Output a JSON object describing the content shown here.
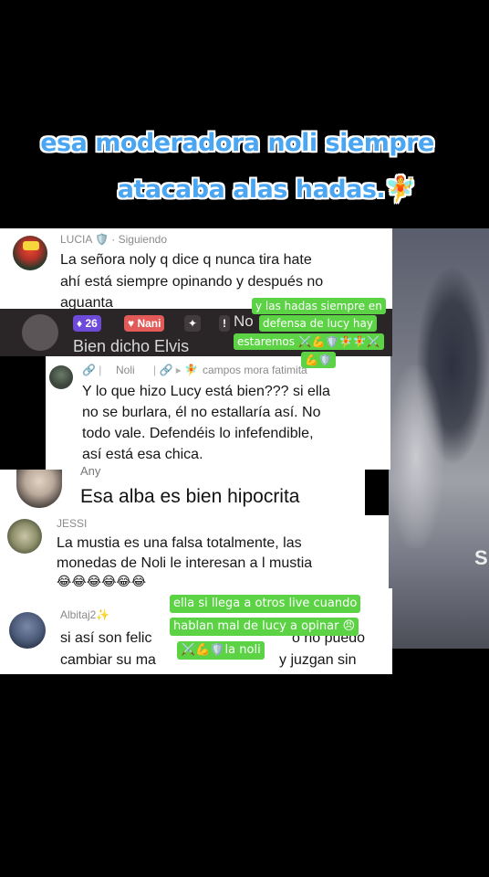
{
  "caption": {
    "line1": "esa moderadora noli siempre",
    "line2": "atacaba alas hadas.🧚"
  },
  "comments": [
    {
      "user": "LUCIA 🛡️ · Siguiendo",
      "lines": [
        "La señora noly q dice q nunca tira hate",
        "ahí está siempre opinando y después no",
        "aguanta"
      ]
    },
    {
      "badge_level": "26",
      "badge_name": "Nani",
      "extra": "No",
      "text": "Bien dicho Elvis"
    },
    {
      "user": "Noli",
      "reply_to": "campos mora fatimita",
      "lines": [
        "Y lo que hizo Lucy está bien??? si ella",
        "no se burlara, él no estallaría así. No",
        "todo vale. Defendéis lo infefendible,",
        "así está esa chica."
      ]
    },
    {
      "user": "Any",
      "text": "Esa alba es bien hipocrita"
    },
    {
      "user": "JESSI",
      "lines": [
        "La mustia es una falsa totalmente, las",
        "monedas de Noli le interesan a l mustia",
        "😂😂😂😂😂😂"
      ]
    },
    {
      "user": "Albitaj2✨",
      "lines": [
        "si así son felic",
        "cambiar su ma"
      ],
      "hidden_tail": [
        "o no puedo",
        "y juzgan sin"
      ]
    }
  ],
  "stickers": {
    "top": [
      "y las hadas siempre en",
      "defensa de lucy hay",
      "estaremos ⚔️💪🛡️🧚🧚⚔️",
      "💪🛡️"
    ],
    "bottom": [
      "ella si llega a otros live cuando",
      "hablan mal de lucy a opinar 😠",
      "⚔️💪🛡️la noli"
    ]
  },
  "video_letter": "S"
}
